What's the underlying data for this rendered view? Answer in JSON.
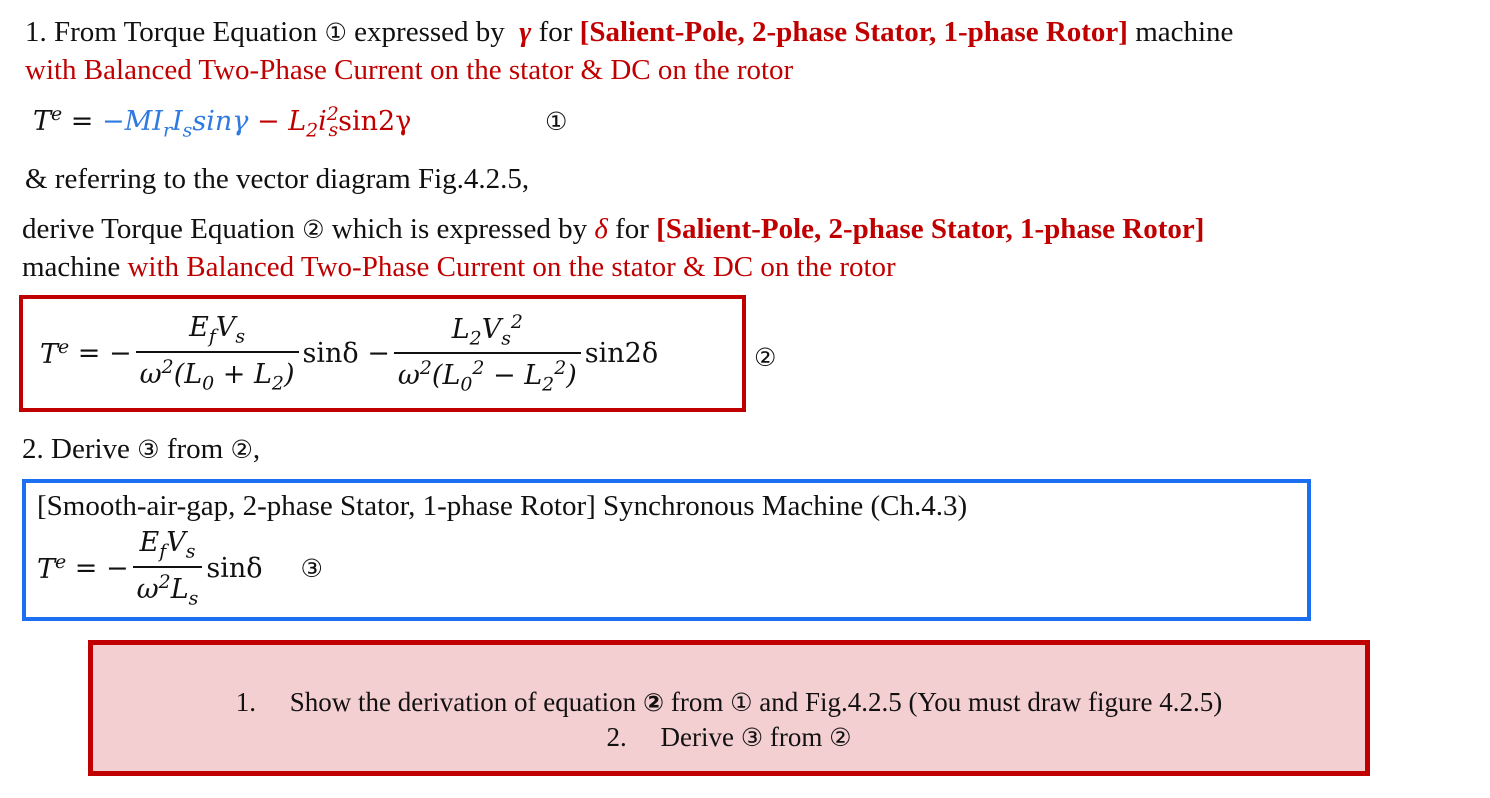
{
  "q1": {
    "line1": {
      "prefix": "1. From Torque Equation",
      "circ": "①",
      "mid": "expressed by",
      "symbol": "γ",
      "for": "for",
      "machine_type": "[Salient-Pole, 2-phase Stator, 1-phase Rotor]",
      "suffix": "machine"
    },
    "line2": "with Balanced Two-Phase Current on the stator & DC on the rotor",
    "eq1": {
      "lhs": "T",
      "lhs_sup": "e",
      "eq": "=",
      "term1": "−MI",
      "term1_sub1": "r",
      "term1_mid": "I",
      "term1_sub2": "s",
      "term1_tail": "sinγ",
      "term2": "− L",
      "term2_sub": "2",
      "term2_i": "i",
      "term2_isub": "s",
      "term2_isup": "2",
      "term2_tail": "sin2γ",
      "label": "①"
    },
    "line3": "& referring to the vector diagram Fig.4.2.5,",
    "line4": {
      "prefix": "derive Torque Equation",
      "circ": "②",
      "mid": "which is expressed by",
      "symbol": "δ",
      "for": "for",
      "machine_type": "[Salient-Pole, 2-phase Stator, 1-phase Rotor]"
    },
    "line5": {
      "prefix": "machine",
      "red": "with Balanced Two-Phase Current on the stator & DC on the rotor"
    },
    "eq2": {
      "lhs": "T",
      "lhs_sup": "e",
      "eq": "= −",
      "f1_num_a": "E",
      "f1_num_a_sub": "f",
      "f1_num_b": "V",
      "f1_num_b_sub": "s",
      "f1_den": "ω",
      "f1_den_sup": "2",
      "f1_den_rest": "(L",
      "f1_den_s1": "0",
      "f1_den_plus": " + L",
      "f1_den_s2": "2",
      "f1_den_close": ")",
      "sin1": "sinδ",
      "minus": "−",
      "f2_num_a": "L",
      "f2_num_a_sub": "2",
      "f2_num_b": "V",
      "f2_num_b_sub": "s",
      "f2_num_b_sup": "2",
      "f2_den": "ω",
      "f2_den_sup": "2",
      "f2_den_open": "(L",
      "f2_den_s1": "0",
      "f2_den_sup1": "2",
      "f2_den_minus": " − L",
      "f2_den_s2": "2",
      "f2_den_sup2": "2",
      "f2_den_close": ")",
      "sin2": "sin2δ",
      "label": "②"
    }
  },
  "q2": {
    "heading": {
      "prefix": "2. Derive",
      "c3": "③",
      "from": "from",
      "c2": "②",
      "suffix": ","
    },
    "box_title": "[Smooth-air-gap, 2-phase Stator, 1-phase Rotor] Synchronous Machine (Ch.4.3)",
    "eq3": {
      "lhs": "T",
      "lhs_sup": "e",
      "eq": "= −",
      "num_a": "E",
      "num_a_sub": "f",
      "num_b": "V",
      "num_b_sub": "s",
      "den": "ω",
      "den_sup": "2",
      "den_b": "L",
      "den_b_sub": "s",
      "sin": "sinδ",
      "label": "③"
    }
  },
  "task_box": {
    "item1_num": "1.",
    "item1_text_a": "Show the derivation of equation",
    "item1_c2": "②",
    "item1_text_b": "from",
    "item1_c1": "①",
    "item1_text_c": "and Fig.4.2.5 (You must draw figure 4.2.5)",
    "item2_num": "2.",
    "item2_text_a": "Derive",
    "item2_c3": "③",
    "item2_text_b": "from",
    "item2_c2": "②"
  },
  "colors": {
    "accent_red": "#c00000",
    "accent_blue": "#2f7ae0",
    "box_blue": "#1c6ff0",
    "note_fill": "#f4cfd1"
  }
}
